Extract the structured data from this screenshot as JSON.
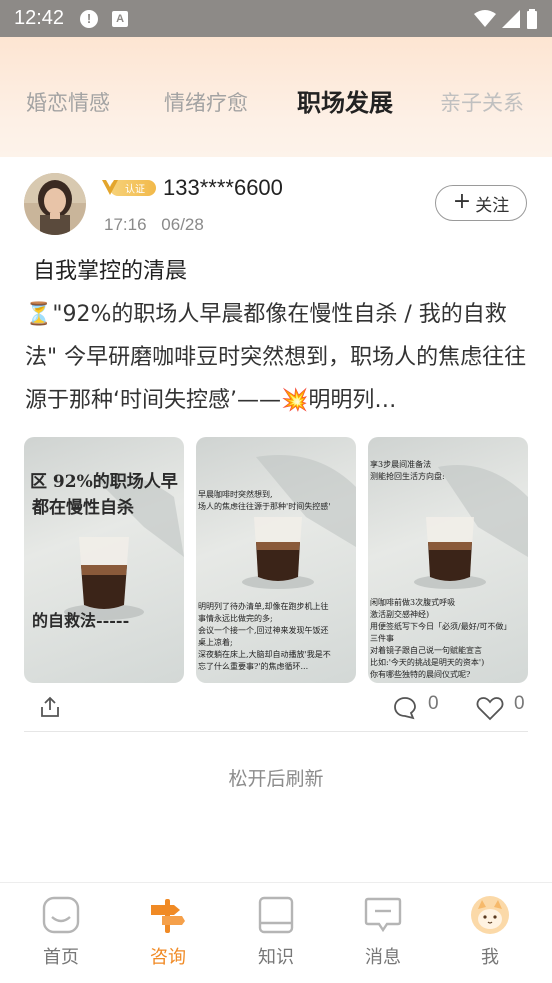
{
  "status_bar": {
    "time": "12:42",
    "alert_icon": "alert-circle-icon",
    "app_icon_letter": "A"
  },
  "tabs": [
    {
      "label": "婚恋情感",
      "active": false
    },
    {
      "label": "情绪疗愈",
      "active": false
    },
    {
      "label": "职场发展",
      "active": true
    },
    {
      "label": "亲子关系",
      "active": false
    }
  ],
  "post": {
    "badge_label": "认证",
    "username": "133****6600",
    "time": "17:16",
    "date": "06/28",
    "follow_label": "关注",
    "title": "自我掌控的清晨",
    "body": "⏳\"92%的职场人早晨都像在慢性自杀 / 我的自救法\" 今早研磨咖啡豆时突然想到，职场人的焦虑往往源于那种‘时间失控感’——💥明明列…",
    "comment_count": "0",
    "like_count": "0",
    "images": [
      {
        "lines": [
          "区 92%的职场人早",
          "都在慢性自杀",
          "的自救法-----"
        ]
      },
      {
        "lines": [
          "早晨咖啡时突然想到,",
          "场人的焦虑往往源于那种'时间失控感'",
          "明明列了待办清单,却像在跑步机上往",
          "事情永远比做完的多;",
          "会议一个接一个,回过神来发现午饭还",
          "桌上凉着;",
          "深夜躺在床上,大脑却自动播放'我是不",
          "忘了什么重要事?'的焦虑循环..."
        ]
      },
      {
        "lines": [
          "享3步晨间准备法",
          "测能抢回生活方向盘:",
          "闲咖啡前做3次腹式呼吸",
          "激活副交感神经)",
          "用便签纸写下今日「必须/最好/可不做」",
          "三件事",
          "对着镜子跟自己说一句赋能宣言",
          "比如:'今天的挑战是明天的资本')",
          "你有哪些独特的晨间仪式呢?"
        ]
      }
    ]
  },
  "refresh_text": "松开后刷新",
  "nav": [
    {
      "label": "首页",
      "icon": "home-icon",
      "active": false
    },
    {
      "label": "咨询",
      "icon": "signpost-icon",
      "active": true
    },
    {
      "label": "知识",
      "icon": "book-icon",
      "active": false
    },
    {
      "label": "消息",
      "icon": "message-icon",
      "active": false
    },
    {
      "label": "我",
      "icon": "profile-avatar-icon",
      "active": false
    }
  ],
  "colors": {
    "accent": "#f08a25",
    "status_bar": "#8d8a87",
    "header_gradient_top": "#fde5d2"
  }
}
